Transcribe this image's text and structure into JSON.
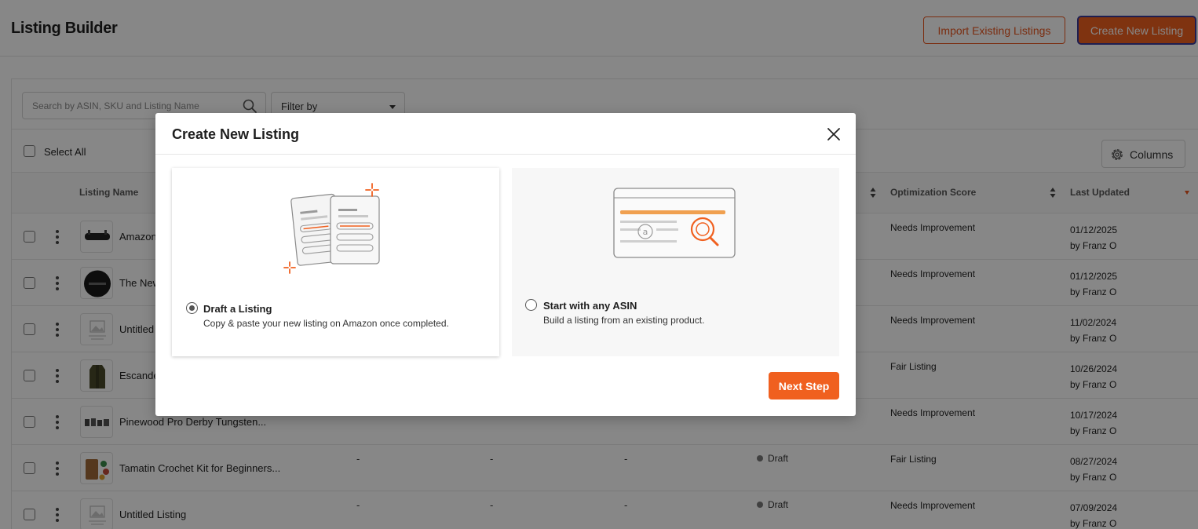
{
  "header": {
    "title": "Listing Builder",
    "import_label": "Import Existing Listings",
    "create_label": "Create New Listing"
  },
  "toolbar": {
    "search_placeholder": "Search by ASIN, SKU and Listing Name",
    "filter_label": "Filter by",
    "select_all_label": "Select All",
    "columns_label": "Columns"
  },
  "table": {
    "columns": {
      "listing_name": "Listing Name",
      "optimization_score": "Optimization Score",
      "last_updated": "Last Updated"
    },
    "rows": [
      {
        "name": "Amazon",
        "c1": "",
        "c2": "",
        "c3": "",
        "status": "",
        "score": "Needs Improvement",
        "date": "01/12/2025",
        "by": "by Franz O"
      },
      {
        "name": "The New",
        "c1": "",
        "c2": "",
        "c3": "",
        "status": "",
        "score": "Needs Improvement",
        "date": "01/12/2025",
        "by": "by Franz O"
      },
      {
        "name": "Untitled",
        "c1": "",
        "c2": "",
        "c3": "",
        "status": "",
        "score": "Needs Improvement",
        "date": "11/02/2024",
        "by": "by Franz O"
      },
      {
        "name": "Escande",
        "c1": "",
        "c2": "",
        "c3": "",
        "status": "",
        "score": "Fair Listing",
        "date": "10/26/2024",
        "by": "by Franz O"
      },
      {
        "name": "Pinewood Pro Derby Tungsten...",
        "c1": "",
        "c2": "",
        "c3": "",
        "status": "",
        "score": "Needs Improvement",
        "date": "10/17/2024",
        "by": "by Franz O"
      },
      {
        "name": "Tamatin Crochet Kit for Beginners...",
        "c1": "-",
        "c2": "-",
        "c3": "-",
        "status": "Draft",
        "score": "Fair Listing",
        "date": "08/27/2024",
        "by": "by Franz O"
      },
      {
        "name": "Untitled Listing",
        "c1": "-",
        "c2": "-",
        "c3": "-",
        "status": "Draft",
        "score": "Needs Improvement",
        "date": "07/09/2024",
        "by": "by Franz O"
      }
    ]
  },
  "modal": {
    "title": "Create New Listing",
    "options": [
      {
        "title": "Draft a Listing",
        "subtitle": "Copy & paste your new listing on Amazon once completed.",
        "selected": true
      },
      {
        "title": "Start with any ASIN",
        "subtitle": "Build a listing from an existing product.",
        "selected": false
      }
    ],
    "next_label": "Next Step"
  },
  "colors": {
    "accent": "#f0601f",
    "accent_border": "#e8561f",
    "focus_ring": "#3a3a9a",
    "overlay": "rgba(0,0,0,0.47)"
  },
  "icons": [
    "search-icon",
    "chevron-down-icon",
    "gear-icon",
    "sort-icon",
    "sort-down-icon",
    "kebab-icon",
    "close-icon",
    "document-stack-icon",
    "asin-search-icon",
    "radio-icon"
  ]
}
